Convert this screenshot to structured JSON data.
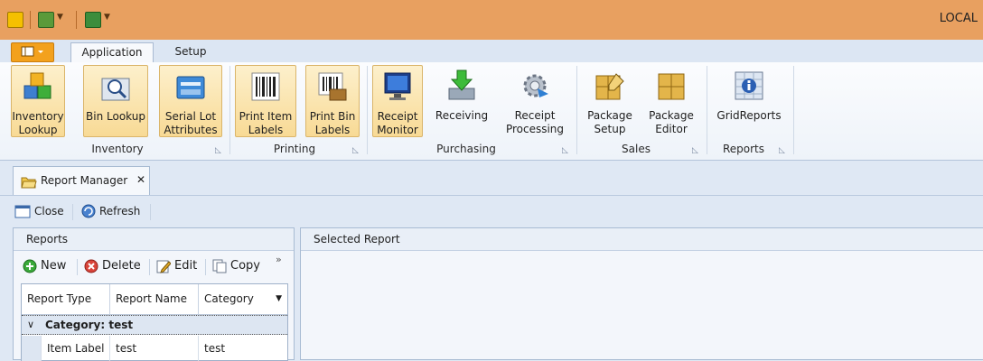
{
  "window": {
    "title": "LOCAL"
  },
  "tabs": [
    {
      "label": "Application",
      "active": true
    },
    {
      "label": "Setup",
      "active": false
    }
  ],
  "ribbon": {
    "groups": [
      {
        "name": "Inventory",
        "buttons": [
          {
            "label": "Inventory\nLookup",
            "icon": "cubes-icon"
          },
          {
            "label": "Bin Lookup",
            "icon": "magnifier-bin-icon"
          },
          {
            "label": "Serial Lot\nAttributes",
            "icon": "card-scanner-icon"
          }
        ]
      },
      {
        "name": "Printing",
        "buttons": [
          {
            "label": "Print Item\nLabels",
            "icon": "barcode-icon"
          },
          {
            "label": "Print Bin\nLabels",
            "icon": "barcode-bin-icon"
          }
        ]
      },
      {
        "name": "Purchasing",
        "buttons": [
          {
            "label": "Receipt\nMonitor",
            "icon": "monitor-icon"
          },
          {
            "label": "Receiving",
            "icon": "receiving-arrow-icon"
          },
          {
            "label": "Receipt\nProcessing",
            "icon": "gear-processing-icon"
          }
        ]
      },
      {
        "name": "Sales",
        "buttons": [
          {
            "label": "Package\nSetup",
            "icon": "package-pencil-icon"
          },
          {
            "label": "Package\nEditor",
            "icon": "package-icon"
          }
        ]
      },
      {
        "name": "Reports",
        "buttons": [
          {
            "label": "GridReports",
            "icon": "grid-info-icon"
          }
        ]
      }
    ]
  },
  "document_tab": {
    "label": "Report Manager",
    "close": "✕"
  },
  "toolbar": {
    "close_label": "Close",
    "refresh_label": "Refresh"
  },
  "reports_panel": {
    "title": "Reports",
    "actions": {
      "new": "New",
      "delete": "Delete",
      "edit": "Edit",
      "copy": "Copy",
      "more": "»"
    },
    "columns": [
      "Report Type",
      "Report Name",
      "Category"
    ],
    "group": {
      "chevron": "∨",
      "label": "Category: test"
    },
    "rows": [
      {
        "type": "Item Label",
        "name": "test",
        "category": "test"
      }
    ]
  },
  "selected_panel": {
    "title": "Selected Report"
  },
  "colors": {
    "titlebar": "#e8a060",
    "accent": "#f3a11d",
    "highlight": "#f8da95"
  }
}
